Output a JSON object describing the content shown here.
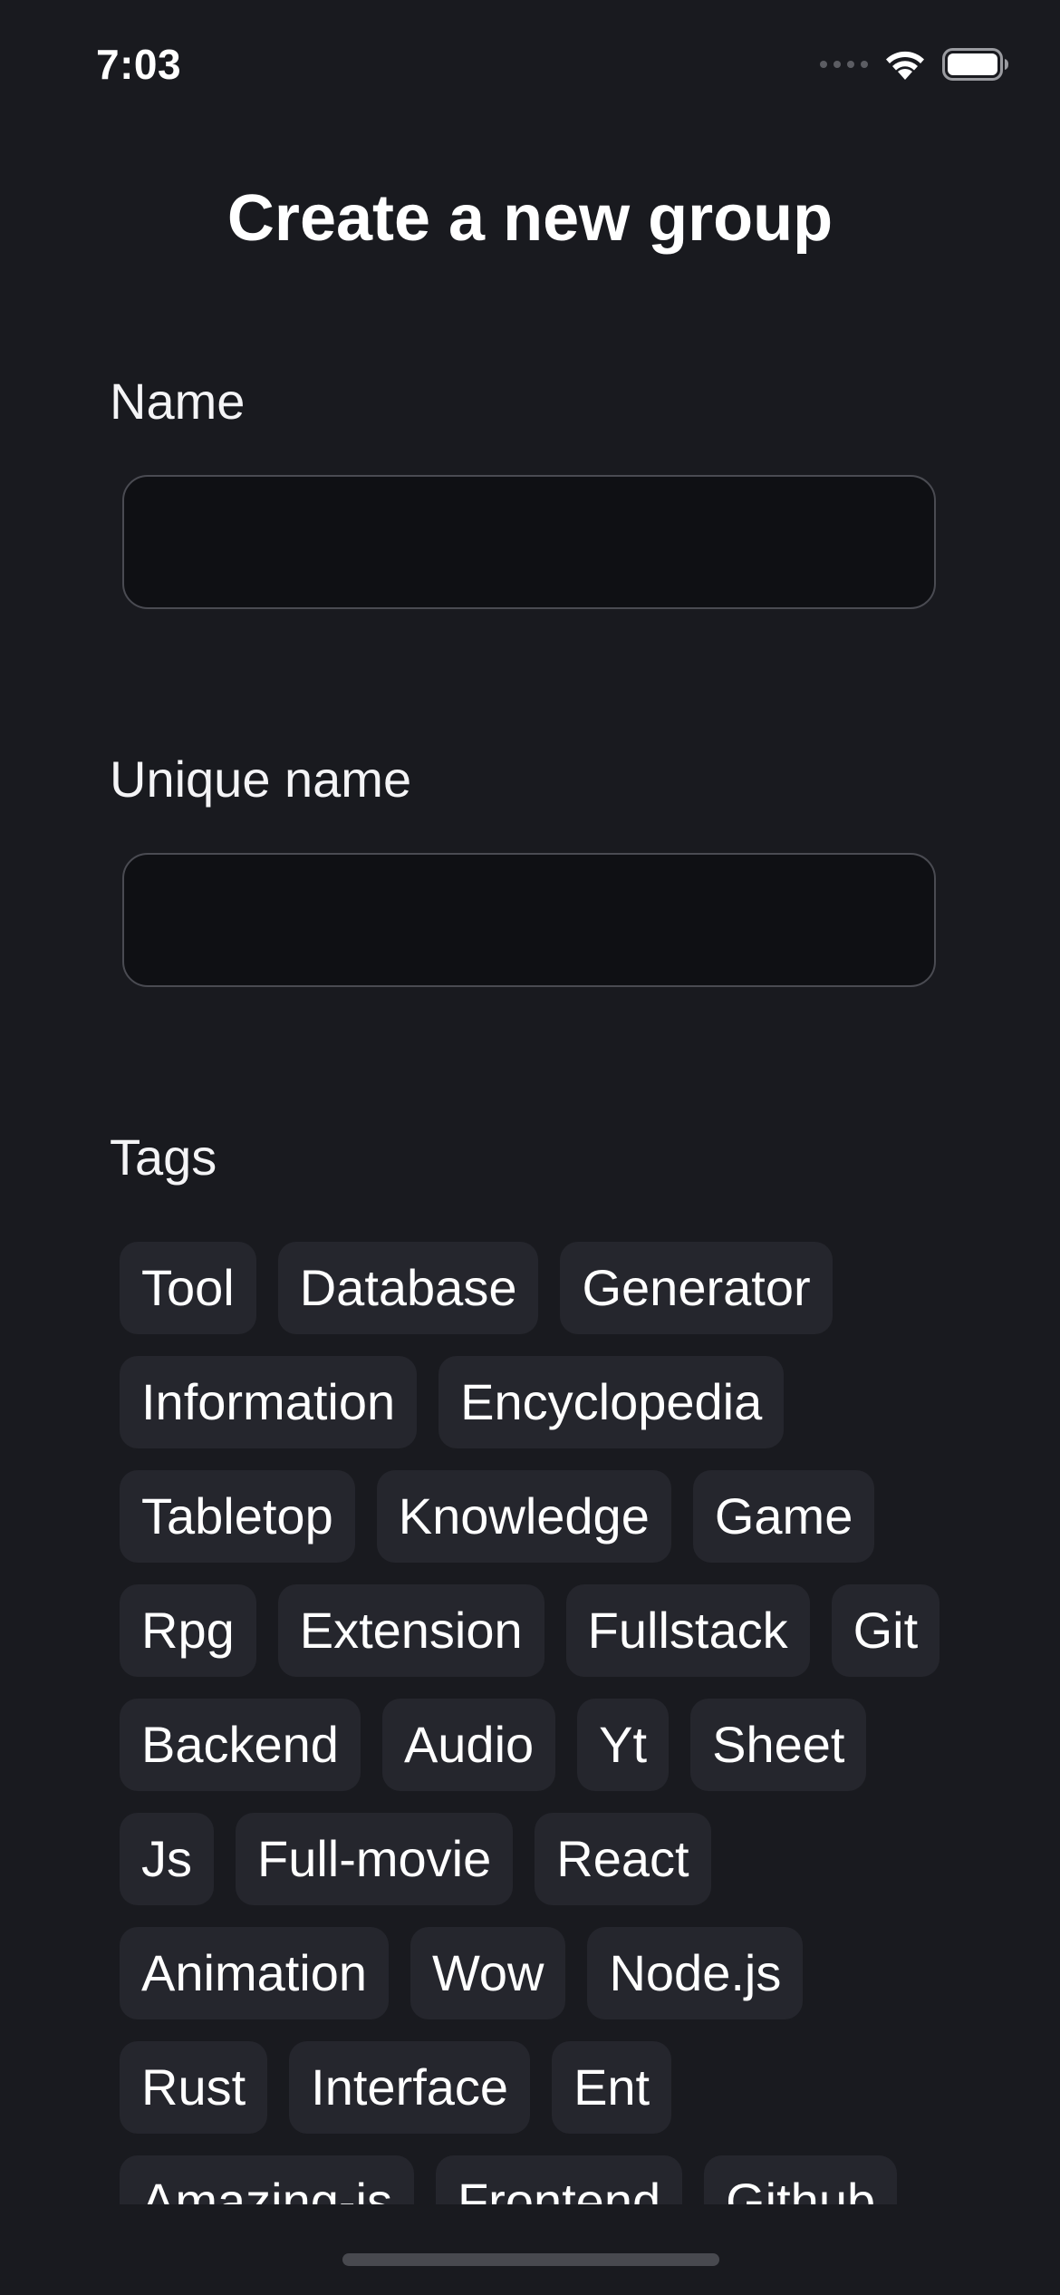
{
  "status_bar": {
    "time": "7:03",
    "icons": [
      "signal-dots-icon",
      "wifi-icon",
      "battery-icon"
    ]
  },
  "page": {
    "title": "Create a new group"
  },
  "form": {
    "name": {
      "label": "Name",
      "value": "",
      "placeholder": ""
    },
    "unique_name": {
      "label": "Unique name",
      "value": "",
      "placeholder": ""
    },
    "tags": {
      "label": "Tags",
      "items": [
        "Tool",
        "Database",
        "Generator",
        "Information",
        "Encyclopedia",
        "Tabletop",
        "Knowledge",
        "Game",
        "Rpg",
        "Extension",
        "Fullstack",
        "Git",
        "Backend",
        "Audio",
        "Yt",
        "Sheet",
        "Js",
        "Full-movie",
        "React",
        "Animation",
        "Wow",
        "Node.js",
        "Rust",
        "Interface",
        "Ent",
        "Amazing-js",
        "Frontend",
        "Github"
      ]
    }
  },
  "colors": {
    "background": "#191a1f",
    "input_background": "#0f1014",
    "input_border": "#4a4b52",
    "chip_background": "#25262d",
    "text": "#ffffff"
  }
}
